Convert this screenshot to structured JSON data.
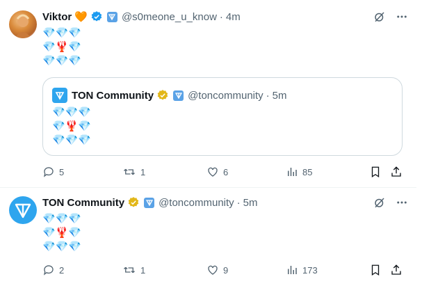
{
  "tweets": [
    {
      "author_name": "Viktor",
      "heart_emoji": "🧡",
      "handle": "@s0meone_u_know",
      "time": "4m",
      "body": "💎💎💎\n💎🦞💎\n💎💎💎",
      "quote": {
        "author_name": "TON Community",
        "handle": "@toncommunity",
        "time": "5m",
        "body": "💎💎💎\n💎🦞💎\n💎💎💎"
      },
      "stats": {
        "replies": "5",
        "reposts": "1",
        "likes": "6",
        "views": "85"
      }
    },
    {
      "author_name": "TON Community",
      "handle": "@toncommunity",
      "time": "5m",
      "body": "💎💎💎\n💎🦞💎\n💎💎💎",
      "stats": {
        "replies": "2",
        "reposts": "1",
        "likes": "9",
        "views": "173"
      }
    }
  ],
  "separator": "·",
  "colors": {
    "verified_blue": "#1d9bf0",
    "verified_gold": "#e2b719",
    "ton_blue": "#2ea5ee",
    "muted": "#536471"
  }
}
